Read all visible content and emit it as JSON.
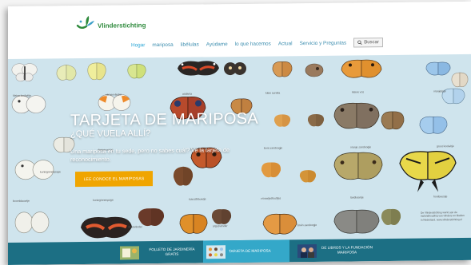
{
  "site": {
    "logo_text": "Vlinderstichting"
  },
  "nav": {
    "items": [
      "Hogar",
      "mariposa",
      "libélulas",
      "Ayúdame",
      "lo que hacemos",
      "Actual",
      "Servicio y Preguntas"
    ],
    "search_label": "Buscar"
  },
  "hero": {
    "title": "TARJETA DE MARIPOSA",
    "subtitle": "¿QUÉ VUELA ALLÍ?",
    "description": "Una mariposa en tu sede, pero no sabes cuál? Ve la tarjeta de reconocimiento.",
    "cta_label": "LEE CONOCE EL MARIPOSAS"
  },
  "captions": {
    "c1": "kleine koolwitje",
    "c2": "citroenvlinder",
    "c3": "atalanta",
    "c4": "klein aurelia",
    "c5": "kleine vos",
    "c6": "oranjetipje",
    "c7": "dagpauwoog",
    "c8": "groot dikkopje",
    "c9": "bont zandoogje",
    "c10": "oranje zandoogje",
    "c11": "groot koolwitje",
    "c12": "boomblauwtje",
    "c13": "koninginnenpage",
    "c14": "icarusblauwtje",
    "c15": "vrouwtjesfuutfjes",
    "c16": "landkaartje",
    "c17": "hooibeestje",
    "c18": "distelvlinder",
    "c19": "argusvlinder",
    "c20": "bruin zandoogje",
    "c21": "koninginnenpage"
  },
  "footer_note": "De Vlinderstichting werkt aan de instandhouding van vlinders en libellen in Nederland. www.vlinderstichting.nl",
  "bottom_tiles": [
    {
      "label": "FOLLETO DE JARDINERÍA GRATIS"
    },
    {
      "label": "TARJETA DE MARIPOSA"
    },
    {
      "label": "DE LIBROS Y LA FUNDACIÓN MARIPOSA"
    }
  ],
  "colors": {
    "hero_background": "#cfe4ed",
    "cta": "#f0a500",
    "bottom_bar": "#1c6f84",
    "bottom_active": "#34a8c9",
    "nav_link": "#3f8fb0",
    "logo_green": "#2e8a3c"
  }
}
